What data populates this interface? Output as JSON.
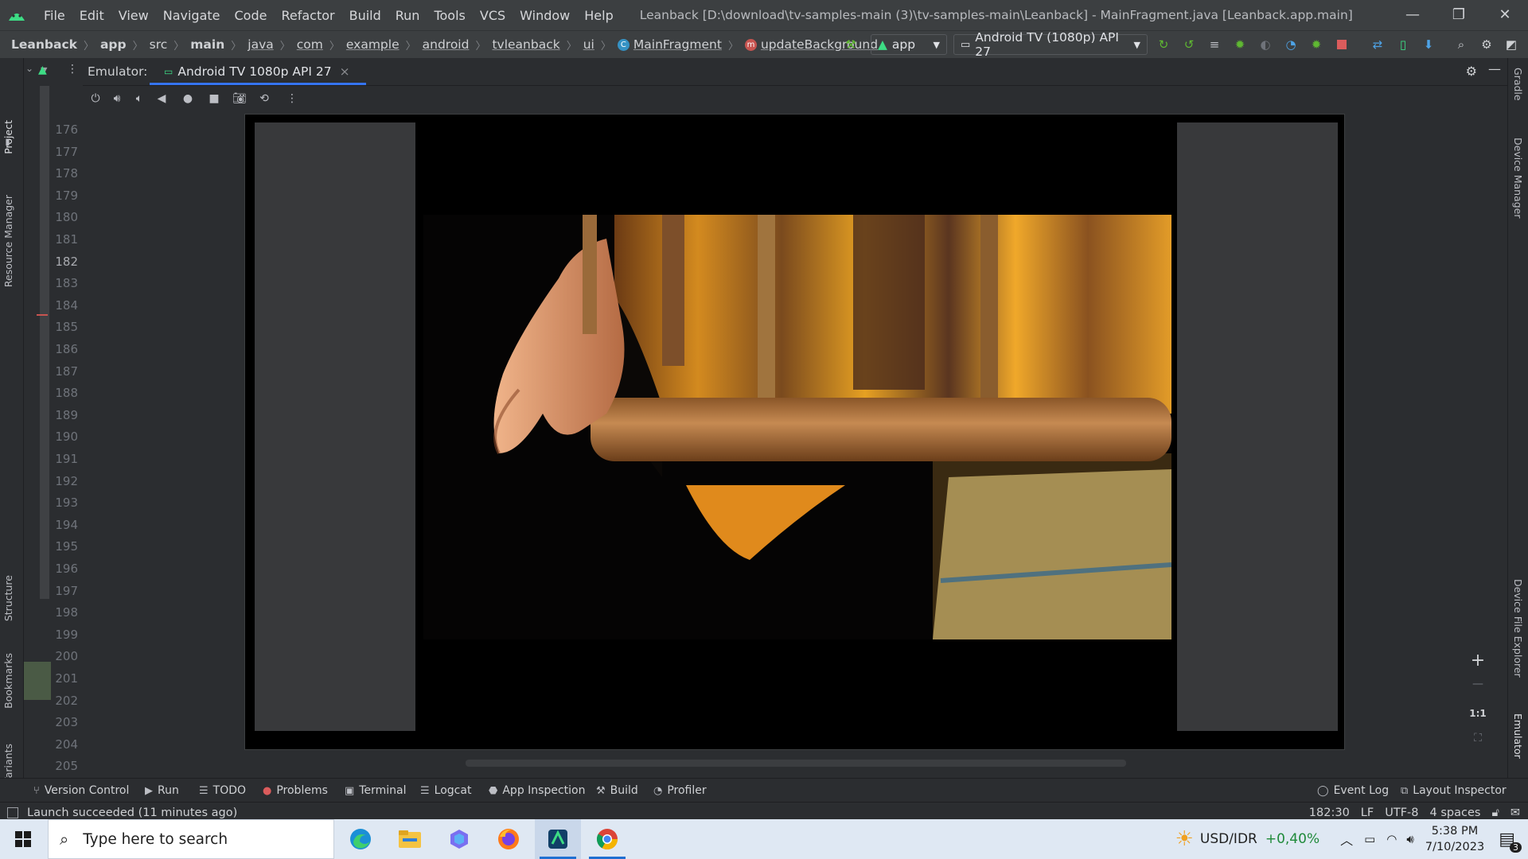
{
  "titlebar": {
    "menu": [
      "File",
      "Edit",
      "View",
      "Navigate",
      "Code",
      "Refactor",
      "Build",
      "Run",
      "Tools",
      "VCS",
      "Window",
      "Help"
    ],
    "title": "Leanback [D:\\download\\tv-samples-main (3)\\tv-samples-main\\Leanback] - MainFragment.java [Leanback.app.main]",
    "minimize": "—",
    "restore": "❐",
    "close": "✕"
  },
  "navbar": {
    "crumbs": [
      "Leanback",
      "app",
      "src",
      "main",
      "java",
      "com",
      "example",
      "android",
      "tvleanback",
      "ui"
    ],
    "class_name": "MainFragment",
    "method_name": "updateBackground",
    "run_config": "app",
    "device": "Android TV (1080p) API 27"
  },
  "left_stripe": {
    "project": "Project",
    "resource_manager": "Resource Manager",
    "structure": "Structure",
    "bookmarks": "Bookmarks",
    "build_variants": "Build Variants"
  },
  "right_stripe": {
    "gradle": "Gradle",
    "device_manager": "Device Manager",
    "device_file_explorer": "Device File Explorer",
    "emulator": "Emulator"
  },
  "gutter": {
    "lines": [
      "176",
      "177",
      "178",
      "179",
      "180",
      "181",
      "182",
      "183",
      "184",
      "185",
      "186",
      "187",
      "188",
      "189",
      "190",
      "191",
      "192",
      "193",
      "194",
      "195",
      "196",
      "197",
      "198",
      "199",
      "200",
      "201",
      "202",
      "203",
      "204",
      "205"
    ],
    "current_line": "182"
  },
  "emulator": {
    "label": "Emulator:",
    "tab": "Android TV 1080p API 27",
    "tab_close": "×",
    "zoom_in": "+",
    "zoom_out": "—",
    "one_to_one": "1:1"
  },
  "bottom_tools": [
    "Version Control",
    "Run",
    "TODO",
    "Problems",
    "Terminal",
    "Logcat",
    "App Inspection",
    "Build",
    "Profiler"
  ],
  "bottom_right_tools": [
    "Event Log",
    "Layout Inspector"
  ],
  "status": {
    "message": "Launch succeeded (11 minutes ago)",
    "position": "182:30",
    "line_sep": "LF",
    "encoding": "UTF-8",
    "indent": "4 spaces"
  },
  "taskbar": {
    "search_placeholder": "Type here to search",
    "ticker_label": "USD/IDR",
    "ticker_value": "+0,40%",
    "time": "5:38 PM",
    "date": "7/10/2023",
    "notifications": "3"
  },
  "colors": {
    "accent": "#3574f0",
    "android_green": "#3ddc84",
    "run_green": "#5fb832",
    "stop_red": "#db5c5c",
    "ticker_green": "#1f8a3a"
  }
}
